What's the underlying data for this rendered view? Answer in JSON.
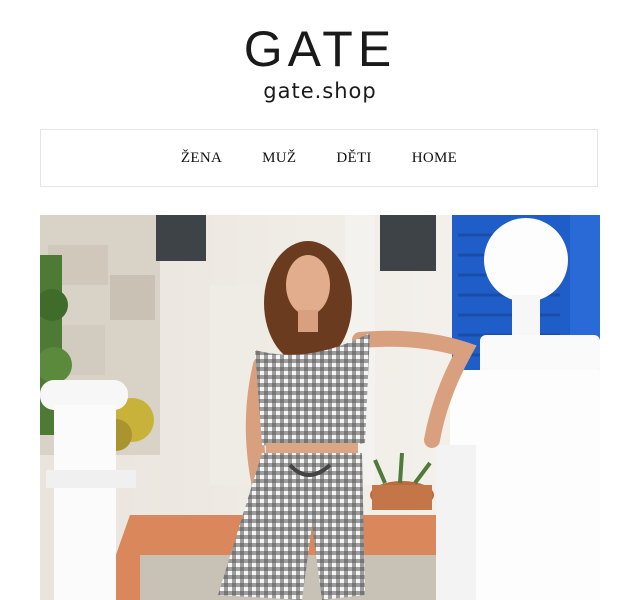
{
  "brand": {
    "name": "GATE",
    "domain": "gate.shop"
  },
  "nav": {
    "items": [
      {
        "label": "ŽENA"
      },
      {
        "label": "MUŽ"
      },
      {
        "label": "DĚTI"
      },
      {
        "label": "HOME"
      }
    ]
  },
  "colors": {
    "shutter_blue": "#1f5ec8",
    "text": "#1a1a1a",
    "nav_border": "#e6e6e6"
  }
}
